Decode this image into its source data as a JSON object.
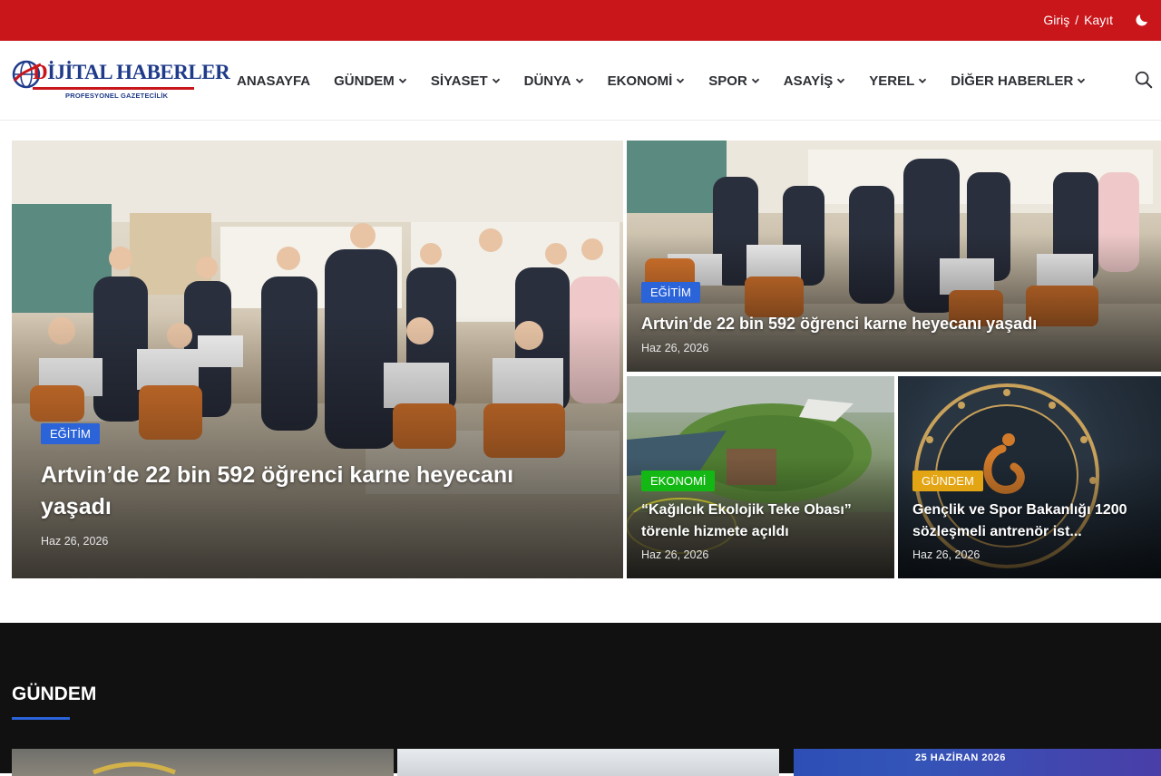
{
  "topbar": {
    "login": "Giriş",
    "separator": "/",
    "register": "Kayıt"
  },
  "logo": {
    "brand_first": "D",
    "brand_rest": "İJİTAL HABERLER",
    "tagline": "PROFESYONEL GAZETECİLİK"
  },
  "nav": {
    "items": [
      {
        "label": "ANASAYFA"
      },
      {
        "label": "GÜNDEM"
      },
      {
        "label": "SİYASET"
      },
      {
        "label": "DÜNYA"
      },
      {
        "label": "EKONOMİ"
      },
      {
        "label": "SPOR"
      },
      {
        "label": "ASAYİŞ"
      },
      {
        "label": "YEREL"
      },
      {
        "label": "DİĞER HABERLER"
      }
    ]
  },
  "hero": {
    "main": {
      "category": "EĞİTİM",
      "category_color": "#2b63d9",
      "title": "Artvin’de 22 bin 592 öğrenci karne heyecanı yaşadı",
      "date": "Haz 26, 2026"
    },
    "top_right": {
      "category": "EĞİTİM",
      "category_color": "#2b63d9",
      "title": "Artvin’de 22 bin 592 öğrenci karne heyecanı yaşadı",
      "date": "Haz 26, 2026"
    },
    "bottom_left": {
      "category": "EKONOMİ",
      "category_color": "#14b814",
      "title": "“Kağılcık Ekolojik Teke Obası” törenle hizmete açıldı",
      "date": "Haz 26, 2026"
    },
    "bottom_right": {
      "category": "GÜNDEM",
      "category_color": "#e3a514",
      "title": "Gençlik ve Spor Bakanlığı 1200 sözleşmeli antrenör ist...",
      "date": "Haz 26, 2026"
    }
  },
  "section": {
    "title": "GÜNDEM",
    "thumb3_text": "25 HAZİRAN 2026"
  },
  "colors": {
    "topbar": "#c9161b",
    "accent_blue": "#2b63d9",
    "dark_bg": "#111111"
  }
}
